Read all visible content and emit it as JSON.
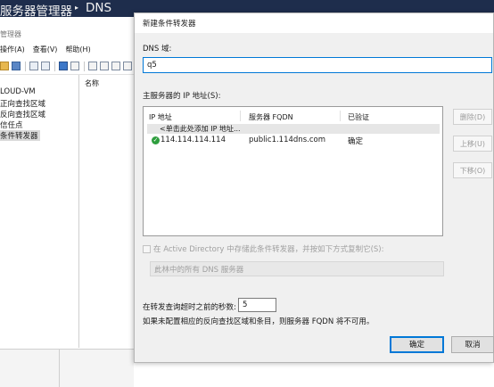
{
  "server_manager": {
    "title": "服务器管理器",
    "separator": "▸",
    "subtitle": "DNS"
  },
  "dns_window": {
    "caption": "管理器",
    "menu": [
      "操作(A)",
      "查看(V)",
      "帮助(H)"
    ],
    "tree": [
      "LOUD-VM",
      "正向查找区域",
      "反向查找区域",
      "信任点",
      "条件转发器"
    ],
    "selected_tree_index": 4,
    "list_header": "名称"
  },
  "dialog": {
    "title": "新建条件转发器",
    "dns_domain_label": "DNS 域:",
    "dns_domain_value": "q5",
    "primary_servers_label": "主服务器的 IP 地址(S):",
    "columns": {
      "ip": "IP 地址",
      "fqdn": "服务器 FQDN",
      "verified": "已验证"
    },
    "add_row_text": "<单击此处添加 IP 地址...",
    "rows": [
      {
        "ip": "114.114.114.114",
        "fqdn": "public1.114dns.com",
        "verified": "确定",
        "status_icon": "check-circle-icon"
      }
    ],
    "side_buttons": {
      "delete": "删除(D)",
      "up": "上移(U)",
      "down": "下移(O)"
    },
    "ad_store_label": "在 Active Directory 中存储此条件转发器，并按如下方式复制它(S):",
    "replication_value": "此林中的所有 DNS 服务器",
    "timeout_label": "在转发查询超时之前的秒数:",
    "timeout_value": "5",
    "note": "如果未配置相应的反向查找区域和条目，则服务器 FQDN 将不可用。",
    "ok_label": "确定",
    "cancel_label": "取消"
  },
  "colors": {
    "title_bar": "#1e2d4c",
    "accent": "#0078d7",
    "success": "#2e9e3e"
  }
}
